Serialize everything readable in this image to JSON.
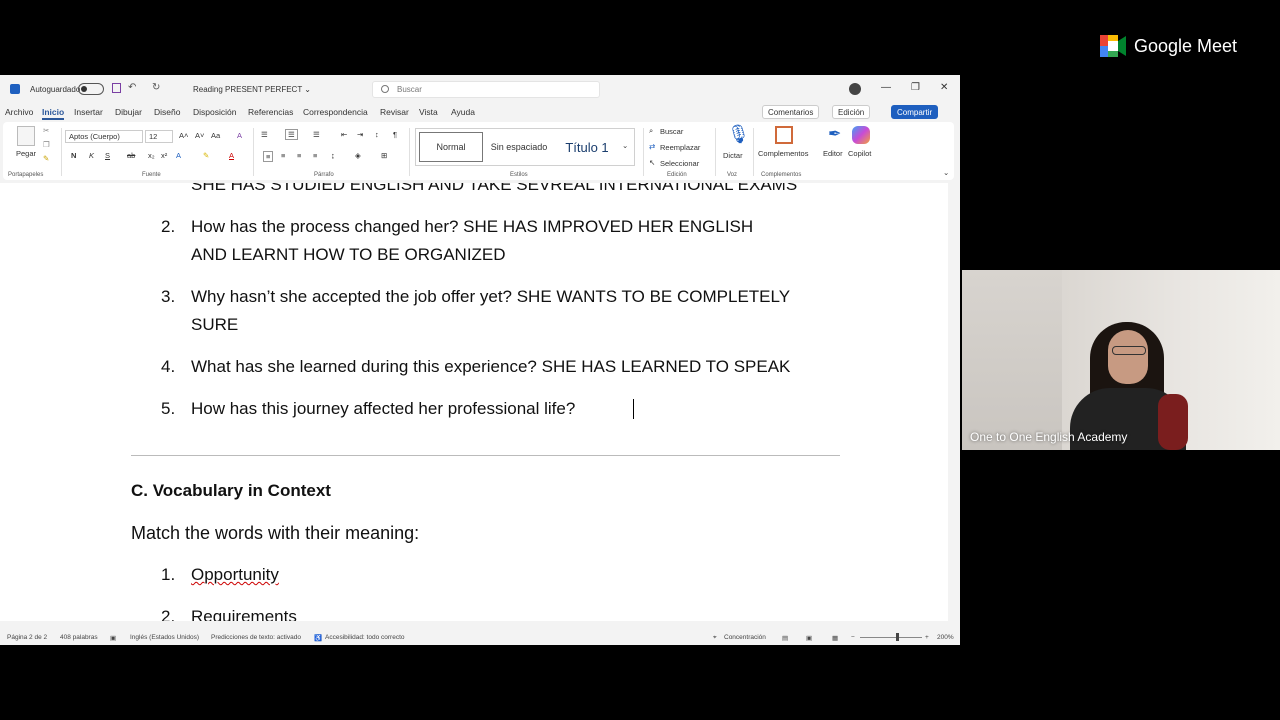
{
  "meet": {
    "logo_text": "Google Meet"
  },
  "titlebar": {
    "autosave_label": "Autoguardado",
    "doc_name": "Reading PRESENT PERFECT ⌄",
    "search_placeholder": "Buscar"
  },
  "menubar": {
    "tabs": [
      "Archivo",
      "Inicio",
      "Insertar",
      "Dibujar",
      "Diseño",
      "Disposición",
      "Referencias",
      "Correspondencia",
      "Revisar",
      "Vista",
      "Ayuda"
    ],
    "comments_label": "Comentarios",
    "edit_label": "Edición",
    "share_label": "Compartir"
  },
  "ribbon": {
    "paste_label": "Pegar",
    "font_name": "Aptos (Cuerpo)",
    "font_size": "12",
    "bold": "N",
    "italic": "K",
    "underline": "S",
    "strike": "ab",
    "styles": [
      "Normal",
      "Sin espaciado",
      "Título 1"
    ],
    "find_label": "Buscar",
    "replace_label": "Reemplazar",
    "select_label": "Seleccionar",
    "dictate_label": "Dictar",
    "addins_label": "Complementos",
    "editor_label": "Editor",
    "copilot_label": "Copilot",
    "groups": [
      "Portapapeles",
      "Fuente",
      "Párrafo",
      "Estilos",
      "Edición",
      "Voz",
      "Complementos"
    ]
  },
  "document": {
    "partial_line": "SHE HAS STUDIED ENGLISH AND TAKE SEVREAL INTERNATIONAL EXAMS",
    "questions": [
      {
        "num": "2.",
        "line1": "How has the process changed her? SHE HAS IMPROVED HER ENGLISH",
        "line2": "AND LEARNT HOW TO BE ORGANIZED"
      },
      {
        "num": "3.",
        "line1": "Why hasn’t she accepted the job offer yet? SHE WANTS TO BE COMPLETELY",
        "line2": "SURE"
      },
      {
        "num": "4.",
        "line1": "What has she learned during this experience? SHE HAS LEARNED TO SPEAK",
        "line2": ""
      },
      {
        "num": "5.",
        "line1": "How has this journey affected her professional life?",
        "line2": ""
      }
    ],
    "section_heading": "C. Vocabulary in Context",
    "instruction": "Match the words with their meaning:",
    "vocab": [
      {
        "num": "1.",
        "word": "Opportunity"
      },
      {
        "num": "2.",
        "word": "Requirements"
      }
    ]
  },
  "statusbar": {
    "page": "Página 2 de 2",
    "words": "408 palabras",
    "language": "Inglés (Estados Unidos)",
    "predictions": "Predicciones de texto: activado",
    "accessibility": "Accesibilidad: todo correcto",
    "focus": "Concentración",
    "zoom": "200%"
  },
  "participant": {
    "name": "One to One English Academy"
  },
  "colors": {
    "word_blue": "#2b579a",
    "share_blue": "#1e5fbf"
  }
}
